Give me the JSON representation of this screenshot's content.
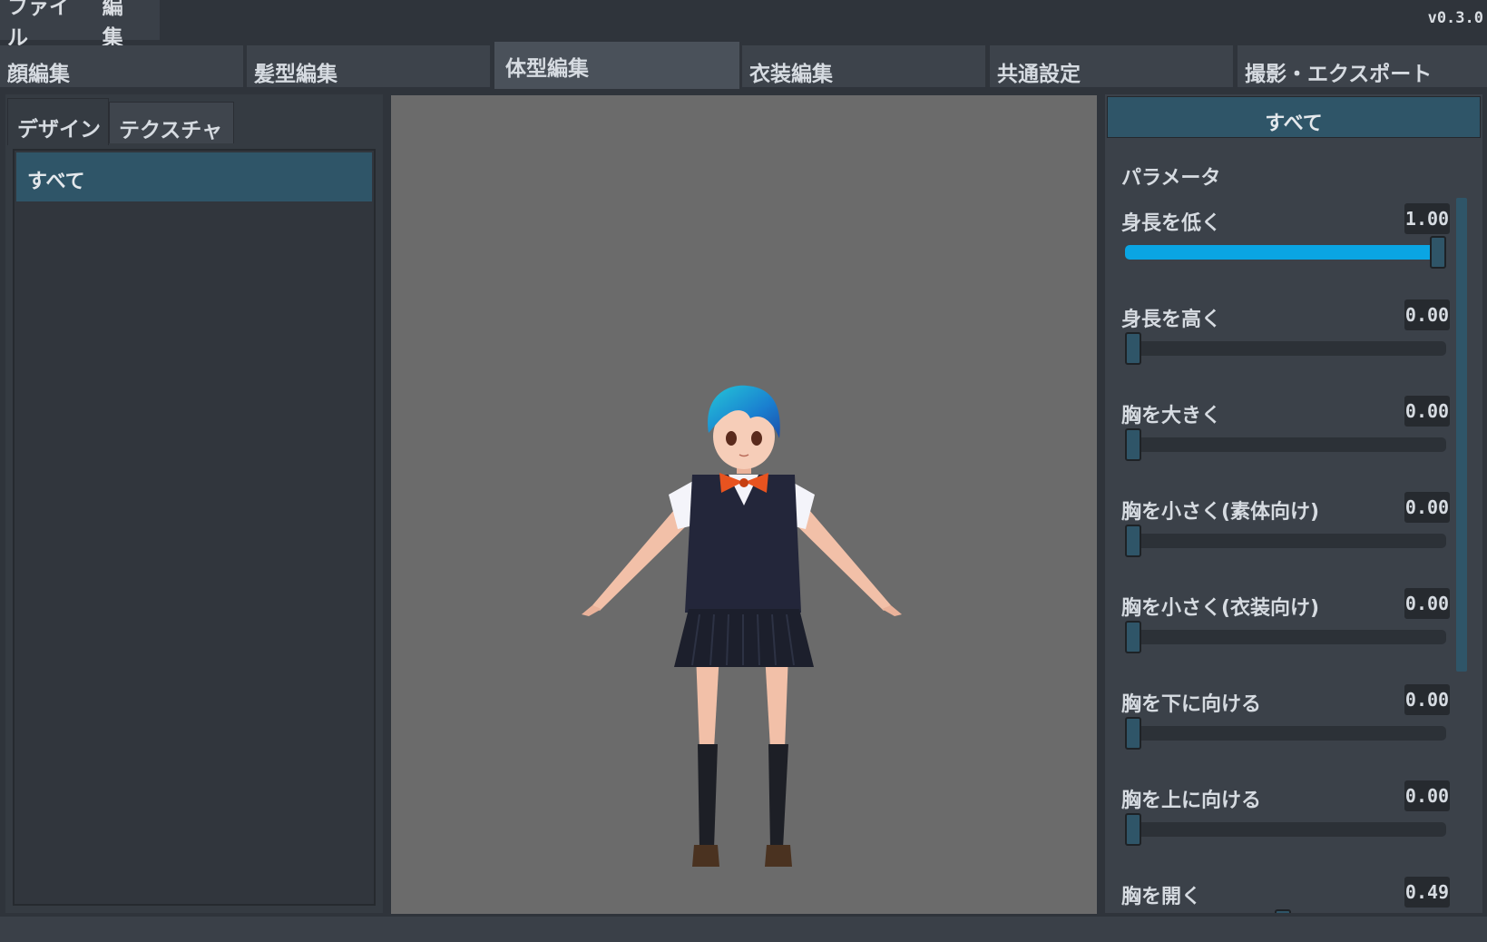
{
  "menu": {
    "file": "ファイル",
    "edit": "編集",
    "version": "v0.3.0"
  },
  "main_tabs": [
    {
      "label": "顔編集"
    },
    {
      "label": "髪型編集"
    },
    {
      "label": "体型編集"
    },
    {
      "label": "衣装編集"
    },
    {
      "label": "共通設定"
    },
    {
      "label": "撮影・エクスポート"
    }
  ],
  "active_main_tab": "体型編集",
  "sub_tabs": [
    {
      "label": "デザイン"
    },
    {
      "label": "テクスチャ"
    }
  ],
  "categories": [
    {
      "label": "すべて"
    }
  ],
  "right_panel": {
    "header": "すべて",
    "section_title": "パラメータ",
    "params": [
      {
        "label": "身長を低く",
        "value": "1.00",
        "level": 1.0
      },
      {
        "label": "身長を高く",
        "value": "0.00",
        "level": 0.0
      },
      {
        "label": "胸を大きく",
        "value": "0.00",
        "level": 0.0
      },
      {
        "label": "胸を小さく(素体向け)",
        "value": "0.00",
        "level": 0.0
      },
      {
        "label": "胸を小さく(衣装向け)",
        "value": "0.00",
        "level": 0.0
      },
      {
        "label": "胸を下に向ける",
        "value": "0.00",
        "level": 0.0
      },
      {
        "label": "胸を上に向ける",
        "value": "0.00",
        "level": 0.0
      },
      {
        "label": "胸を開く",
        "value": "0.49",
        "level": 0.49
      }
    ]
  },
  "colors": {
    "accent": "#0aa5e3",
    "selected": "#2f5568",
    "viewport_bg": "#6b6b6b",
    "hair": "#1a7fd0",
    "vest": "#23263a",
    "bow": "#e8531f"
  }
}
